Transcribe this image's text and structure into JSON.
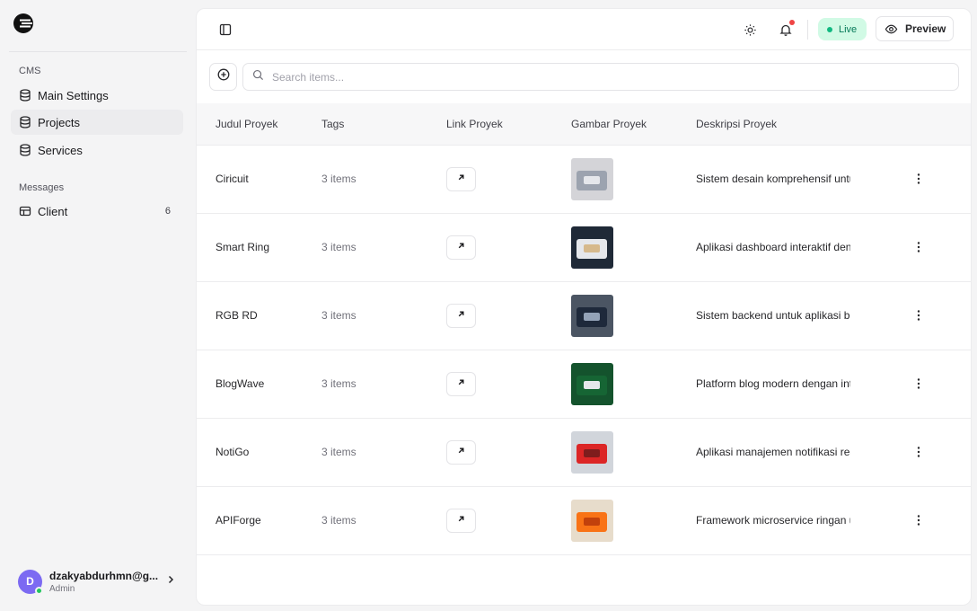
{
  "sidebar": {
    "logo_icon": "brand-logo",
    "sections": [
      {
        "label": "CMS"
      },
      {
        "label": "Messages"
      }
    ],
    "items": [
      {
        "label": "Main Settings",
        "icon": "database-icon"
      },
      {
        "label": "Projects",
        "icon": "database-icon",
        "active": true
      },
      {
        "label": "Services",
        "icon": "database-icon"
      },
      {
        "label": "Client",
        "icon": "table-icon",
        "badge": "6"
      }
    ],
    "user": {
      "initial": "D",
      "email": "dzakyabdurhmn@g...",
      "role": "Admin",
      "status_color": "#22c55e"
    }
  },
  "topbar": {
    "live_label": "Live",
    "preview_label": "Preview",
    "notification_dot_color": "#ef4444"
  },
  "toolbar": {
    "search_placeholder": "Search items..."
  },
  "table": {
    "columns": [
      "Judul Proyek",
      "Tags",
      "Link Proyek",
      "Gambar Proyek",
      "Deskripsi Proyek"
    ],
    "rows": [
      {
        "title": "Ciricuit",
        "tags": "3 items",
        "description": "Sistem desain komprehensif untuk",
        "image_palette": [
          "#d4d4d8",
          "#9ca3af",
          "#e5e7eb"
        ]
      },
      {
        "title": "Smart Ring",
        "tags": "3 items",
        "description": "Aplikasi dashboard interaktif dengan",
        "image_palette": [
          "#1f2937",
          "#e5e7eb",
          "#d6b98c"
        ]
      },
      {
        "title": "RGB RD",
        "tags": "3 items",
        "description": "Sistem backend untuk aplikasi berbasis",
        "image_palette": [
          "#4b5563",
          "#1e293b",
          "#94a3b8"
        ]
      },
      {
        "title": "BlogWave",
        "tags": "3 items",
        "description": "Platform blog modern dengan integrasi",
        "image_palette": [
          "#14532d",
          "#166534",
          "#e5e7eb"
        ]
      },
      {
        "title": "NotiGo",
        "tags": "3 items",
        "description": "Aplikasi manajemen notifikasi real-time",
        "image_palette": [
          "#d1d5db",
          "#dc2626",
          "#7f1d1d"
        ]
      },
      {
        "title": "APIForge",
        "tags": "3 items",
        "description": "Framework microservice ringan untuk",
        "image_palette": [
          "#e7dccb",
          "#f97316",
          "#c2410c"
        ]
      }
    ]
  }
}
